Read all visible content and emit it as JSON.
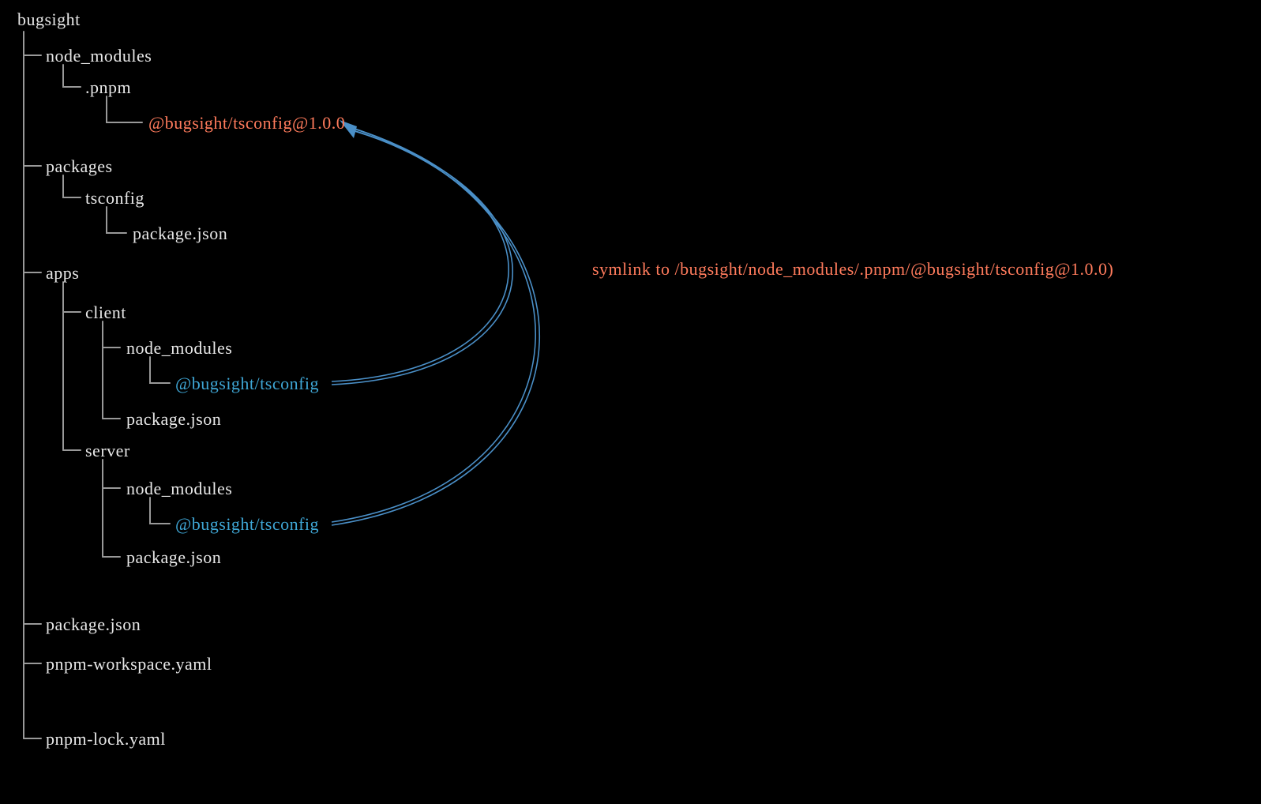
{
  "colors": {
    "background": "#000000",
    "text": "#e8e8e8",
    "highlight_orange": "#ff7b5c",
    "highlight_blue": "#3fa7d6",
    "tree_line": "#999999",
    "arrow": "#4a8fc7"
  },
  "annotation": "symlink to /bugsight/node_modules/.pnpm/@bugsight/tsconfig@1.0.0)",
  "tree": {
    "root": "bugsight",
    "node_modules": {
      "label": "node_modules",
      "pnpm": {
        "label": ".pnpm",
        "package": "@bugsight/tsconfig@1.0.0"
      }
    },
    "packages": {
      "label": "packages",
      "tsconfig": {
        "label": "tsconfig",
        "file": "package.json"
      }
    },
    "apps": {
      "label": "apps",
      "client": {
        "label": "client",
        "node_modules": {
          "label": "node_modules",
          "symlink": "@bugsight/tsconfig"
        },
        "file": "package.json"
      },
      "server": {
        "label": "server",
        "node_modules": {
          "label": "node_modules",
          "symlink": "@bugsight/tsconfig"
        },
        "file": "package.json"
      }
    },
    "files": {
      "package_json": "package.json",
      "workspace": "pnpm-workspace.yaml",
      "lock": "pnpm-lock.yaml"
    }
  }
}
